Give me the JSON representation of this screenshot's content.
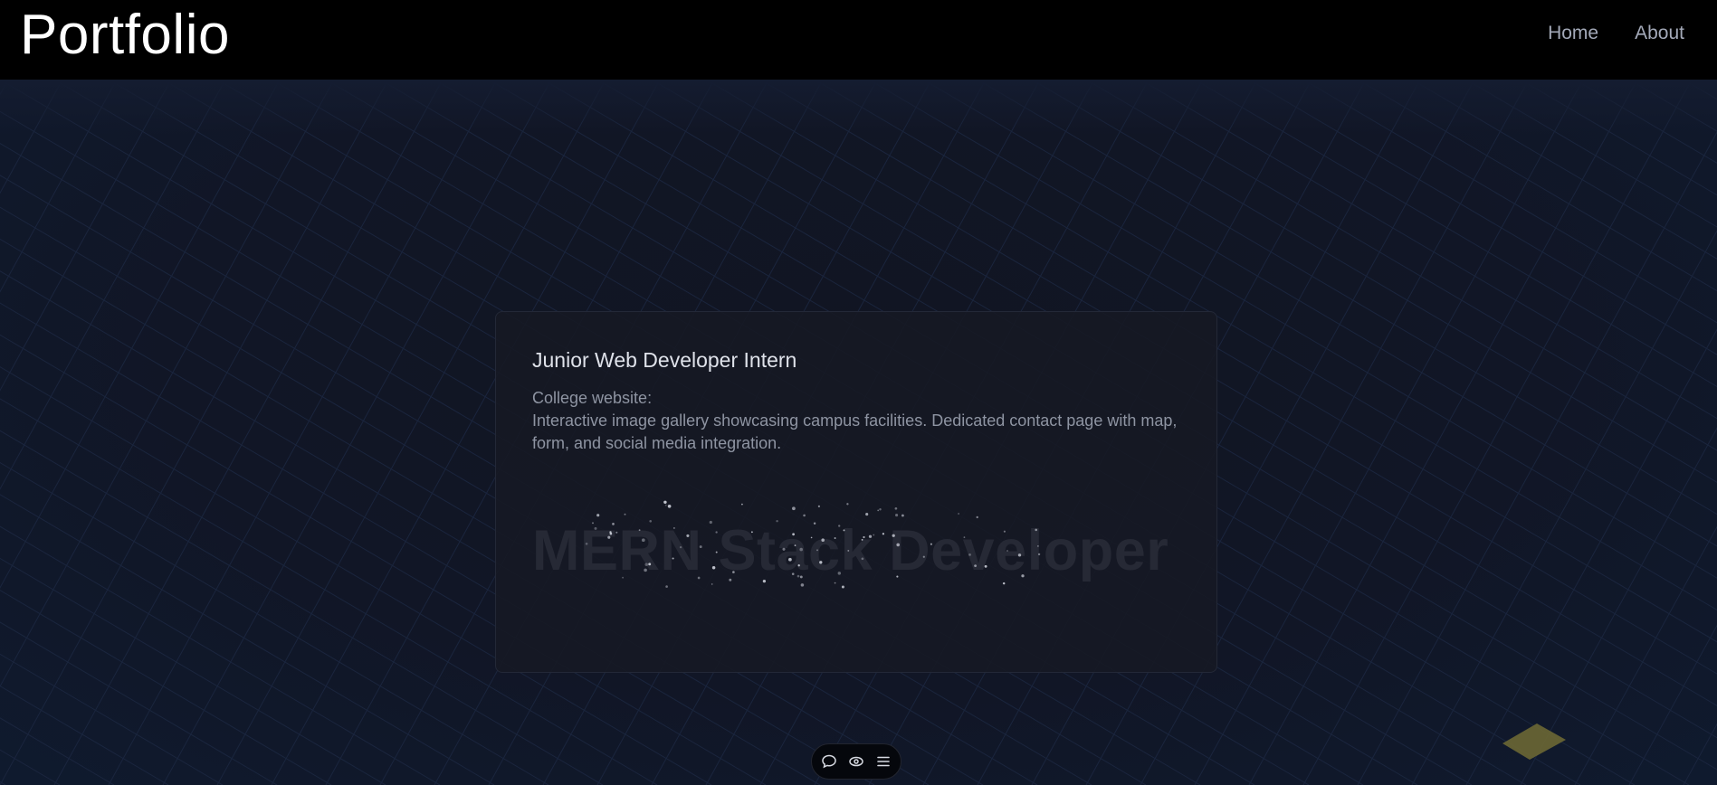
{
  "header": {
    "brand": "Portfolio",
    "nav": [
      {
        "label": "Home"
      },
      {
        "label": "About"
      }
    ]
  },
  "card": {
    "title": "Junior Web Developer Intern",
    "subtitle": "College website:",
    "description": "Interactive image gallery showcasing campus facilities. Dedicated contact page with map, form, and social media integration.",
    "headline": "MERN Stack Developer"
  },
  "toolbar": {
    "items": [
      {
        "icon": "chat-bubble-icon"
      },
      {
        "icon": "eye-icon"
      },
      {
        "icon": "menu-icon"
      }
    ]
  },
  "colors": {
    "background": "#0f1422",
    "navbar": "#000000",
    "card": "#161924",
    "grid_line": "#1e2a40",
    "tile": "#6b6734"
  }
}
